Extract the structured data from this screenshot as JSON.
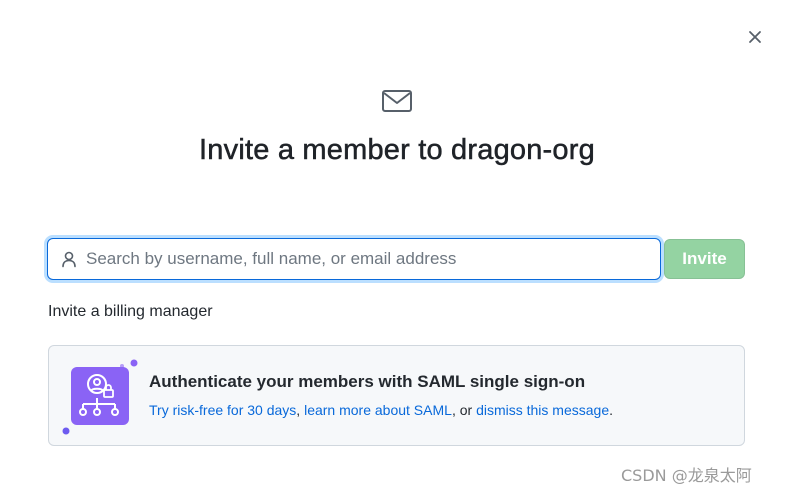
{
  "dialog": {
    "close_icon": "close-icon",
    "header_icon": "mail-icon",
    "title": "Invite a member to dragon-org"
  },
  "search": {
    "icon": "person-icon",
    "value": "",
    "placeholder": "Search by username, full name, or email address"
  },
  "invite_button": {
    "label": "Invite",
    "state": "disabled",
    "color": "#94d3a2"
  },
  "billing_link": "Invite a billing manager",
  "saml_banner": {
    "icon": "saml-org-icon",
    "heading": "Authenticate your members with SAML single sign-on",
    "link_trial": "Try risk-free for 30 days",
    "separator_1": ", ",
    "link_learn": "learn more about SAML",
    "separator_2": ", or ",
    "link_dismiss": "dismiss this message",
    "end": "."
  },
  "watermark": "CSDN @龙泉太阿",
  "colors": {
    "accent": "#0969da",
    "focus_ring": "#54aeff",
    "banner_bg": "#f6f8fa",
    "icon_purple": "#8a63f5"
  }
}
